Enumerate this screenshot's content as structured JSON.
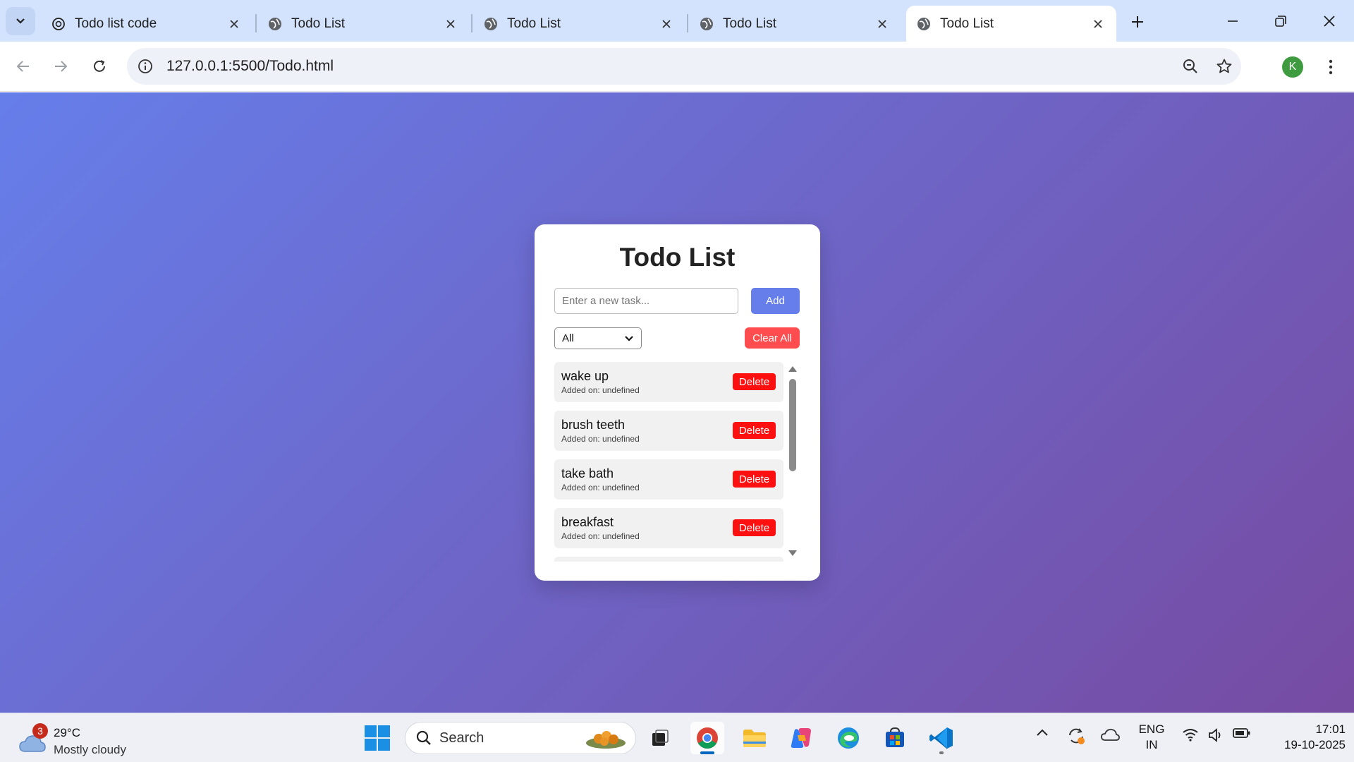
{
  "browser": {
    "tabs": [
      {
        "title": "Todo list code",
        "active": false
      },
      {
        "title": "Todo List",
        "active": false
      },
      {
        "title": "Todo List",
        "active": false
      },
      {
        "title": "Todo List",
        "active": false
      },
      {
        "title": "Todo List",
        "active": true
      }
    ],
    "url": "127.0.0.1:5500/Todo.html",
    "profile_initial": "K"
  },
  "app": {
    "title": "Todo List",
    "input_placeholder": "Enter a new task...",
    "add_label": "Add",
    "filter_selected": "All",
    "clear_label": "Clear All",
    "tasks": [
      {
        "text": "wake up",
        "date": "Added on: undefined",
        "delete_label": "Delete"
      },
      {
        "text": "brush teeth",
        "date": "Added on: undefined",
        "delete_label": "Delete"
      },
      {
        "text": "take bath",
        "date": "Added on: undefined",
        "delete_label": "Delete"
      },
      {
        "text": "breakfast",
        "date": "Added on: undefined",
        "delete_label": "Delete"
      }
    ],
    "colors": {
      "accent": "#667eea",
      "gradient_end": "#764ba2",
      "delete": "#ff1010",
      "clear": "#ff4d4f"
    }
  },
  "taskbar": {
    "weather_badge": "3",
    "temperature": "29°C",
    "condition": "Mostly cloudy",
    "search_label": "Search",
    "language_line1": "ENG",
    "language_line2": "IN",
    "time": "17:01",
    "date": "19-10-2025"
  }
}
